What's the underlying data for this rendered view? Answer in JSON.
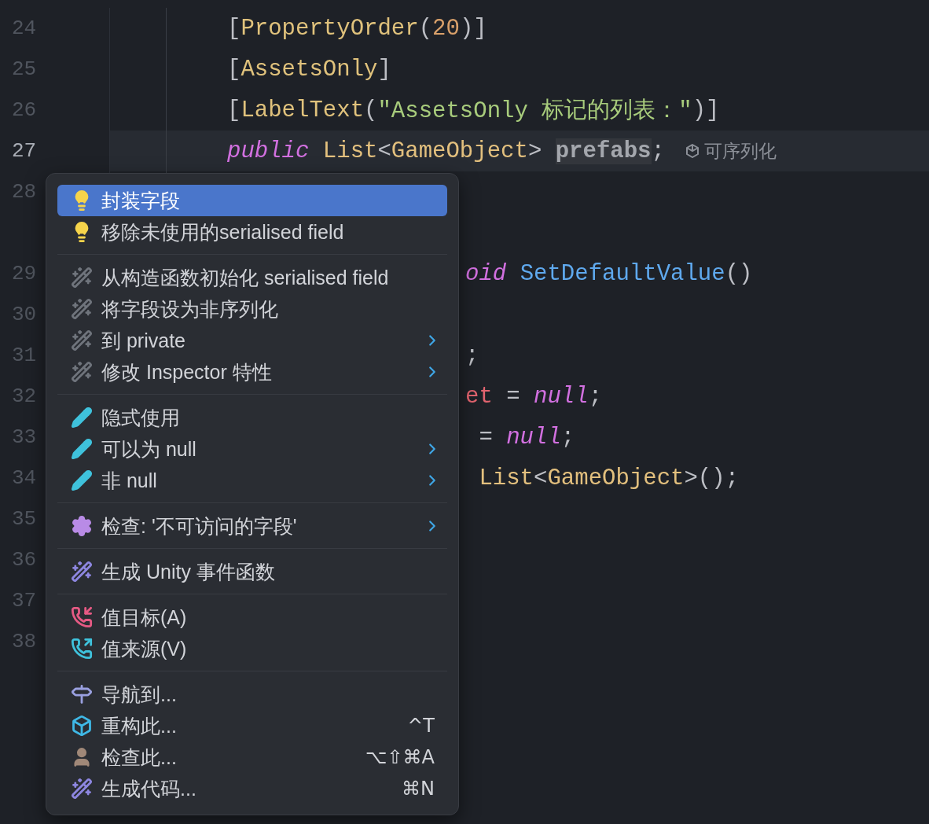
{
  "editor": {
    "lines": [
      {
        "number": "24",
        "current": false,
        "covered": false,
        "tokens": [
          {
            "text": "[",
            "kind": "punct"
          },
          {
            "text": "PropertyOrder",
            "kind": "attr"
          },
          {
            "text": "(",
            "kind": "punct"
          },
          {
            "text": "20",
            "kind": "number"
          },
          {
            "text": ")]",
            "kind": "punct"
          }
        ]
      },
      {
        "number": "25",
        "current": false,
        "covered": false,
        "tokens": [
          {
            "text": "[",
            "kind": "punct"
          },
          {
            "text": "AssetsOnly",
            "kind": "attr"
          },
          {
            "text": "]",
            "kind": "punct"
          }
        ]
      },
      {
        "number": "26",
        "current": false,
        "covered": false,
        "tokens": [
          {
            "text": "[",
            "kind": "punct"
          },
          {
            "text": "LabelText",
            "kind": "attr"
          },
          {
            "text": "(",
            "kind": "punct"
          },
          {
            "text": "\"AssetsOnly 标记的列表：\"",
            "kind": "string"
          },
          {
            "text": ")]",
            "kind": "punct"
          }
        ]
      },
      {
        "number": "27",
        "current": true,
        "covered": false,
        "tokens": [
          {
            "text": "public ",
            "kind": "keyword"
          },
          {
            "text": "List",
            "kind": "type"
          },
          {
            "text": "<",
            "kind": "punct"
          },
          {
            "text": "GameObject",
            "kind": "type"
          },
          {
            "text": "> ",
            "kind": "punct"
          },
          {
            "text": "prefabs",
            "kind": "field"
          },
          {
            "text": ";",
            "kind": "punct"
          },
          {
            "text": "可序列化",
            "kind": "hint"
          }
        ]
      },
      {
        "number": "28",
        "current": false,
        "spacer_after": true
      },
      {
        "number": "29",
        "current": false,
        "covered": true,
        "tokens": [
          {
            "text": "oid ",
            "kind": "keyword"
          },
          {
            "text": "SetDefaultValue",
            "kind": "method"
          },
          {
            "text": "()",
            "kind": "punct"
          }
        ]
      },
      {
        "number": "30",
        "current": false
      },
      {
        "number": "31",
        "current": false,
        "covered": true,
        "tokens": [
          {
            "text": ";",
            "kind": "punct"
          }
        ]
      },
      {
        "number": "32",
        "current": false,
        "covered": true,
        "tokens": [
          {
            "text": "et",
            "kind": "local"
          },
          {
            "text": " = ",
            "kind": "punct"
          },
          {
            "text": "null",
            "kind": "keyword"
          },
          {
            "text": ";",
            "kind": "punct"
          }
        ]
      },
      {
        "number": "33",
        "current": false,
        "covered": true,
        "tokens": [
          {
            "text": " = ",
            "kind": "punct"
          },
          {
            "text": "null",
            "kind": "keyword"
          },
          {
            "text": ";",
            "kind": "punct"
          }
        ]
      },
      {
        "number": "34",
        "current": false,
        "covered": true,
        "tokens": [
          {
            "text": " List",
            "kind": "type"
          },
          {
            "text": "<",
            "kind": "punct"
          },
          {
            "text": "GameObject",
            "kind": "type"
          },
          {
            "text": ">();",
            "kind": "punct"
          }
        ]
      },
      {
        "number": "35",
        "current": false
      },
      {
        "number": "36",
        "current": false
      },
      {
        "number": "37",
        "current": false
      },
      {
        "number": "38",
        "current": false
      }
    ]
  },
  "context_menu": {
    "groups": [
      {
        "items": [
          {
            "label": "封装字段",
            "kind": "quick-fix",
            "selected": true,
            "submenu": false
          },
          {
            "label": "移除未使用的serialised field",
            "kind": "quick-fix",
            "selected": false,
            "submenu": false
          }
        ]
      },
      {
        "items": [
          {
            "label": "从构造函数初始化 serialised field",
            "kind": "action",
            "selected": false,
            "submenu": false
          },
          {
            "label": "将字段设为非序列化",
            "kind": "action",
            "selected": false,
            "submenu": false
          },
          {
            "label": "到 private",
            "kind": "action",
            "selected": false,
            "submenu": true
          },
          {
            "label": "修改 Inspector 特性",
            "kind": "action",
            "selected": false,
            "submenu": true
          }
        ]
      },
      {
        "items": [
          {
            "label": "隐式使用",
            "kind": "annotate",
            "selected": false,
            "submenu": false
          },
          {
            "label": "可以为 null",
            "kind": "annotate",
            "selected": false,
            "submenu": true
          },
          {
            "label": "非 null",
            "kind": "annotate",
            "selected": false,
            "submenu": true
          }
        ]
      },
      {
        "items": [
          {
            "label": "检查: '不可访问的字段'",
            "kind": "inspection",
            "selected": false,
            "submenu": true
          }
        ]
      },
      {
        "items": [
          {
            "label": "生成 Unity 事件函数",
            "kind": "generate",
            "selected": false,
            "submenu": false
          }
        ]
      },
      {
        "items": [
          {
            "label": "值目标(A)",
            "kind": "value-target",
            "selected": false,
            "submenu": false
          },
          {
            "label": "值来源(V)",
            "kind": "value-source",
            "selected": false,
            "submenu": false
          }
        ]
      },
      {
        "items": [
          {
            "label": "导航到...",
            "kind": "navigate",
            "selected": false,
            "submenu": false
          },
          {
            "label": "重构此...",
            "kind": "refactor",
            "selected": false,
            "submenu": false,
            "shortcut": "^T"
          },
          {
            "label": "检查此...",
            "kind": "inspect",
            "selected": false,
            "submenu": false,
            "shortcut": "⌥⇧⌘A"
          },
          {
            "label": "生成代码...",
            "kind": "generate",
            "selected": false,
            "submenu": false,
            "shortcut": "⌘N"
          }
        ]
      }
    ]
  }
}
